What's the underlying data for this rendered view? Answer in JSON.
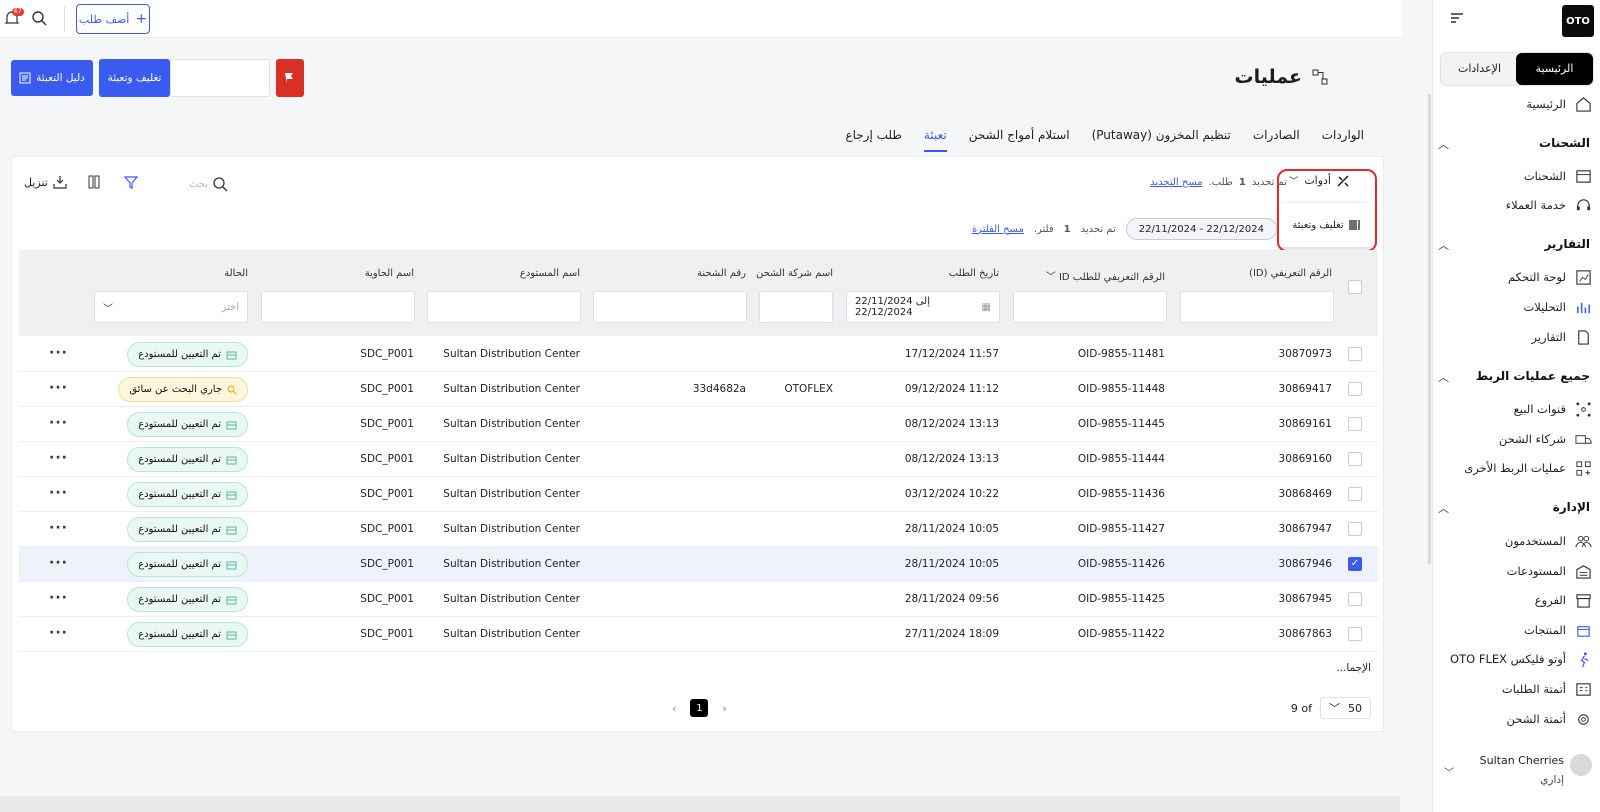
{
  "topbar": {
    "add_order": "أضف طلب",
    "notifications_count": "67"
  },
  "sidebar": {
    "logo": "OTO",
    "segment": {
      "home": "الرئيسية",
      "settings": "الإعدادات"
    },
    "home": "الرئيسية",
    "sections": [
      {
        "title": "الشحنات",
        "items": [
          "الشحنات",
          "خدمة العملاء"
        ]
      },
      {
        "title": "التقارير",
        "items": [
          "لوحة التحكم",
          "التحليلات",
          "التقارير"
        ]
      },
      {
        "title": "جميع عمليات الربط",
        "items": [
          "قنوات البيع",
          "شركاء الشحن",
          "عمليات الربط الأخرى"
        ]
      },
      {
        "title": "الإدارة",
        "items": [
          "المستخدمون",
          "المستودعات",
          "الفروع",
          "المنتجات",
          "أوتو فليكس OTO FLEX",
          "أتمتة الطلبات",
          "أتمتة الشحن"
        ]
      }
    ],
    "user": {
      "name": "Sultan Cherries",
      "role": "إداري"
    }
  },
  "page": {
    "title": "عمليات",
    "pack_button": "تغليف وتعبئة",
    "guide_button": "دليل التعبئة"
  },
  "tabs": [
    "الواردات",
    "الصادرات",
    "تنظيم المخزون (Putaway)",
    "استلام أمواج الشحن",
    "تعبئة",
    "طلب إرجاع"
  ],
  "toolbar": {
    "tools_label": "أدوات",
    "tools_menu_item": "تغليف وتعبئة",
    "selected_prefix": "تم تحديد",
    "selected_count": "1",
    "selected_suffix": "طلب.",
    "clear_selection": "مسح التحديد",
    "date_filter": "22/11/2024 - 22/12/2024",
    "filters_prefix": "تم تحديد",
    "filters_count": "1",
    "filters_suffix": "فلتر.",
    "clear_filter": "مسح الفلترة",
    "search_placeholder": "بحث",
    "download": "تنزيل"
  },
  "table": {
    "columns": [
      "الرقم التعريفي (ID)",
      "الرقم التعريفي للطلب ID",
      "تاريخ الطلب",
      "اسم شركة الشحن",
      "رقم الشحنة",
      "اسم المستودع",
      "اسم الحاوية",
      "الحالة"
    ],
    "date_filter_value": "22/11/2024 إلى 22/12/2024",
    "status_placeholder": "اختر",
    "rows": [
      {
        "id": "30870973",
        "order_id": "OID-9855-11481",
        "date": "11:57 17/12/2024",
        "carrier": "",
        "shipment": "",
        "warehouse": "Sultan Distribution Center",
        "container": "SDC_P001",
        "status": "تم التعيين للمستودع",
        "status_type": "assigned",
        "selected": false
      },
      {
        "id": "30869417",
        "order_id": "OID-9855-11448",
        "date": "11:12 09/12/2024",
        "carrier": "OTOFLEX",
        "shipment": "33d4682a",
        "warehouse": "Sultan Distribution Center",
        "container": "SDC_P001",
        "status": "جاري البحث عن سائق",
        "status_type": "searching",
        "selected": false
      },
      {
        "id": "30869161",
        "order_id": "OID-9855-11445",
        "date": "13:13 08/12/2024",
        "carrier": "",
        "shipment": "",
        "warehouse": "Sultan Distribution Center",
        "container": "SDC_P001",
        "status": "تم التعيين للمستودع",
        "status_type": "assigned",
        "selected": false
      },
      {
        "id": "30869160",
        "order_id": "OID-9855-11444",
        "date": "13:13 08/12/2024",
        "carrier": "",
        "shipment": "",
        "warehouse": "Sultan Distribution Center",
        "container": "SDC_P001",
        "status": "تم التعيين للمستودع",
        "status_type": "assigned",
        "selected": false
      },
      {
        "id": "30868469",
        "order_id": "OID-9855-11436",
        "date": "10:22 03/12/2024",
        "carrier": "",
        "shipment": "",
        "warehouse": "Sultan Distribution Center",
        "container": "SDC_P001",
        "status": "تم التعيين للمستودع",
        "status_type": "assigned",
        "selected": false
      },
      {
        "id": "30867947",
        "order_id": "OID-9855-11427",
        "date": "10:05 28/11/2024",
        "carrier": "",
        "shipment": "",
        "warehouse": "Sultan Distribution Center",
        "container": "SDC_P001",
        "status": "تم التعيين للمستودع",
        "status_type": "assigned",
        "selected": false
      },
      {
        "id": "30867946",
        "order_id": "OID-9855-11426",
        "date": "10:05 28/11/2024",
        "carrier": "",
        "shipment": "",
        "warehouse": "Sultan Distribution Center",
        "container": "SDC_P001",
        "status": "تم التعيين للمستودع",
        "status_type": "assigned",
        "selected": true
      },
      {
        "id": "30867945",
        "order_id": "OID-9855-11425",
        "date": "09:56 28/11/2024",
        "carrier": "",
        "shipment": "",
        "warehouse": "Sultan Distribution Center",
        "container": "SDC_P001",
        "status": "تم التعيين للمستودع",
        "status_type": "assigned",
        "selected": false
      },
      {
        "id": "30867863",
        "order_id": "OID-9855-11422",
        "date": "18:09 27/11/2024",
        "carrier": "",
        "shipment": "",
        "warehouse": "Sultan Distribution Center",
        "container": "SDC_P001",
        "status": "تم التعيين للمستودع",
        "status_type": "assigned",
        "selected": false
      }
    ],
    "total_label": "الإجما..."
  },
  "pagination": {
    "current_page": "1",
    "per_page": "50",
    "of_label": "9 of"
  },
  "colors": {
    "primary": "#3a5bf0",
    "danger": "#d93025",
    "assigned_bg": "#e9f8f4",
    "searching_bg": "#fff6dc"
  }
}
